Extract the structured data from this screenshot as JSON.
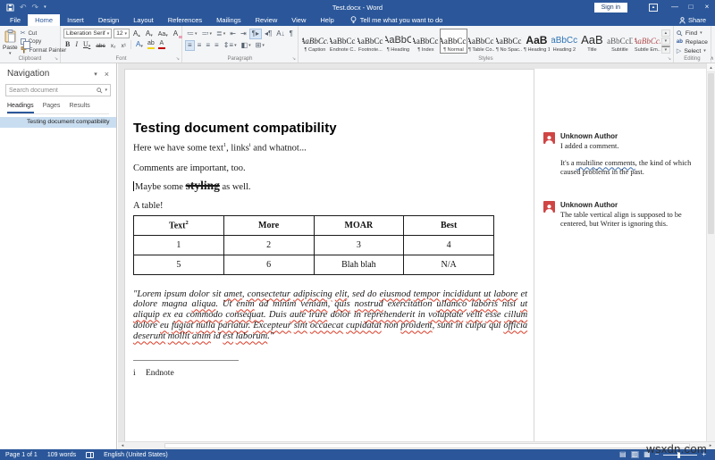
{
  "titlebar": {
    "title": "Test.docx - Word",
    "sign_in": "Sign in"
  },
  "tabs": [
    {
      "label": "File",
      "file": true
    },
    {
      "label": "Home",
      "active": true
    },
    {
      "label": "Insert"
    },
    {
      "label": "Design"
    },
    {
      "label": "Layout"
    },
    {
      "label": "References"
    },
    {
      "label": "Mailings"
    },
    {
      "label": "Review"
    },
    {
      "label": "View"
    },
    {
      "label": "Help"
    }
  ],
  "tabrow": {
    "tell_me": "Tell me what you want to do",
    "share": "Share"
  },
  "ribbon": {
    "groups": {
      "clipboard": "Clipboard",
      "font": "Font",
      "paragraph": "Paragraph",
      "styles": "Styles",
      "editing": "Editing"
    },
    "clipboard": {
      "paste": "Paste",
      "cut": "Cut",
      "copy": "Copy",
      "format_painter": "Format Painter"
    },
    "font": {
      "name": "Liberation Serif",
      "size": "12"
    },
    "styles": [
      {
        "sample": "AaBbCcI",
        "label": "¶ Caption",
        "cls": "st-caption"
      },
      {
        "sample": "AaBbCcI",
        "label": "Endnote C..."
      },
      {
        "sample": "AaBbCcI",
        "label": "Footnote..."
      },
      {
        "sample": "AaBbC",
        "label": "¶ Heading",
        "cls": "st-heading"
      },
      {
        "sample": "AaBbCcI",
        "label": "¶ Index"
      },
      {
        "sample": "AaBbCcI",
        "label": "¶ Normal",
        "selected": true
      },
      {
        "sample": "AaBbCcI",
        "label": "¶ Table Co..."
      },
      {
        "sample": "AaBbCcI",
        "label": "¶ No Spac..."
      },
      {
        "sample": "AaB",
        "label": "¶ Heading 1",
        "cls": "st-h1"
      },
      {
        "sample": "AaBbCcD",
        "label": "Heading 2",
        "cls": "st-h2"
      },
      {
        "sample": "AaB",
        "label": "Title",
        "cls": "st-title"
      },
      {
        "sample": "AaBbCcDc",
        "label": "Subtitle",
        "cls": "st-subtitle"
      },
      {
        "sample": "AaBbCcI",
        "label": "Subtle Em...",
        "cls": "st-subtle"
      }
    ],
    "editing": {
      "find": "Find",
      "replace": "Replace",
      "select": "Select"
    }
  },
  "navigation": {
    "title": "Navigation",
    "search_placeholder": "Search document",
    "tabs": [
      {
        "label": "Headings",
        "active": true
      },
      {
        "label": "Pages"
      },
      {
        "label": "Results"
      }
    ],
    "items": [
      "Testing document compatibility"
    ]
  },
  "document": {
    "heading": "Testing document compatibility",
    "para1": {
      "pre": "Here we have some text",
      "footnote_ref": "1",
      "mid": ", links",
      "endnote_ref": "i",
      "post": " and whatnot..."
    },
    "para2": "Comments are important, too.",
    "para3": {
      "pre": "Maybe some ",
      "styled": "styling",
      "post": " as well."
    },
    "para4": "A table!",
    "table": {
      "headers": [
        "Text",
        "More",
        "MOAR",
        "Best"
      ],
      "header_footnote": "2",
      "rows": [
        [
          "1",
          "2",
          "3",
          "4"
        ],
        [
          "5",
          "6",
          "Blah blah",
          "N/A"
        ]
      ]
    },
    "lorem": "\"Lorem ipsum dolor sit amet, consectetur adipiscing elit, sed do eiusmod tempor incididunt ut labore et dolore magna aliqua. Ut enim ad minim veniam, quis nostrud exercitation ullamco laboris nisi ut aliquip ex ea commodo consequat. Duis aute irure dolor in reprehenderit in voluptate velit esse cillum dolore eu fugiat nulla pariatur. Excepteur sint occaecat cupidatat non proident, sunt in culpa qui officia deserunt mollit anim id est laborum.\"",
    "misspelled": [
      "amet",
      "consectetur",
      "adipiscing",
      "elit",
      "eiusmod",
      "tempor",
      "incididunt",
      "ut",
      "labore",
      "aliqua",
      "enim",
      "veniam",
      "quis",
      "nostrud",
      "ullamco",
      "laboris",
      "aliquip",
      "ea",
      "commodo",
      "consequat",
      "aute",
      "irure",
      "reprehenderit",
      "voluptate",
      "velit",
      "esse",
      "cillum",
      "eu",
      "fugiat",
      "nulla",
      "pariatur",
      "Excepteur",
      "sint",
      "occaecat",
      "cupidatat",
      "proident",
      "officia",
      "deserunt",
      "mollit",
      "anim",
      "est",
      "laborum"
    ],
    "endnote": {
      "marker": "i",
      "text": "Endnote"
    }
  },
  "comments": [
    {
      "author": "Unknown Author",
      "paragraphs": [
        [
          {
            "t": "I added a comment."
          }
        ],
        [
          {
            "t": "It's a "
          },
          {
            "t": "multiline comments",
            "wavy": true
          },
          {
            "t": ", the kind of which caused problems in the past."
          }
        ]
      ]
    },
    {
      "author": "Unknown Author",
      "paragraphs": [
        [
          {
            "t": "The table vertical align is supposed to be centered, but Writer is ignoring this."
          }
        ]
      ]
    }
  ],
  "statusbar": {
    "page": "Page 1 of 1",
    "words": "109 words",
    "language": "English (United States)"
  },
  "watermark": "wsxdn.com",
  "colors": {
    "accent": "#2b579a",
    "ribbon_bg": "#f4f5f7",
    "doc_bg": "#e7e7e7",
    "nav_highlight": "#c9ddf0",
    "spell_wavy": "#d93a26",
    "grammar_wavy": "#3f6fae",
    "comment_avatar": "#cf4544",
    "heading2_blue": "#2e74b5"
  }
}
